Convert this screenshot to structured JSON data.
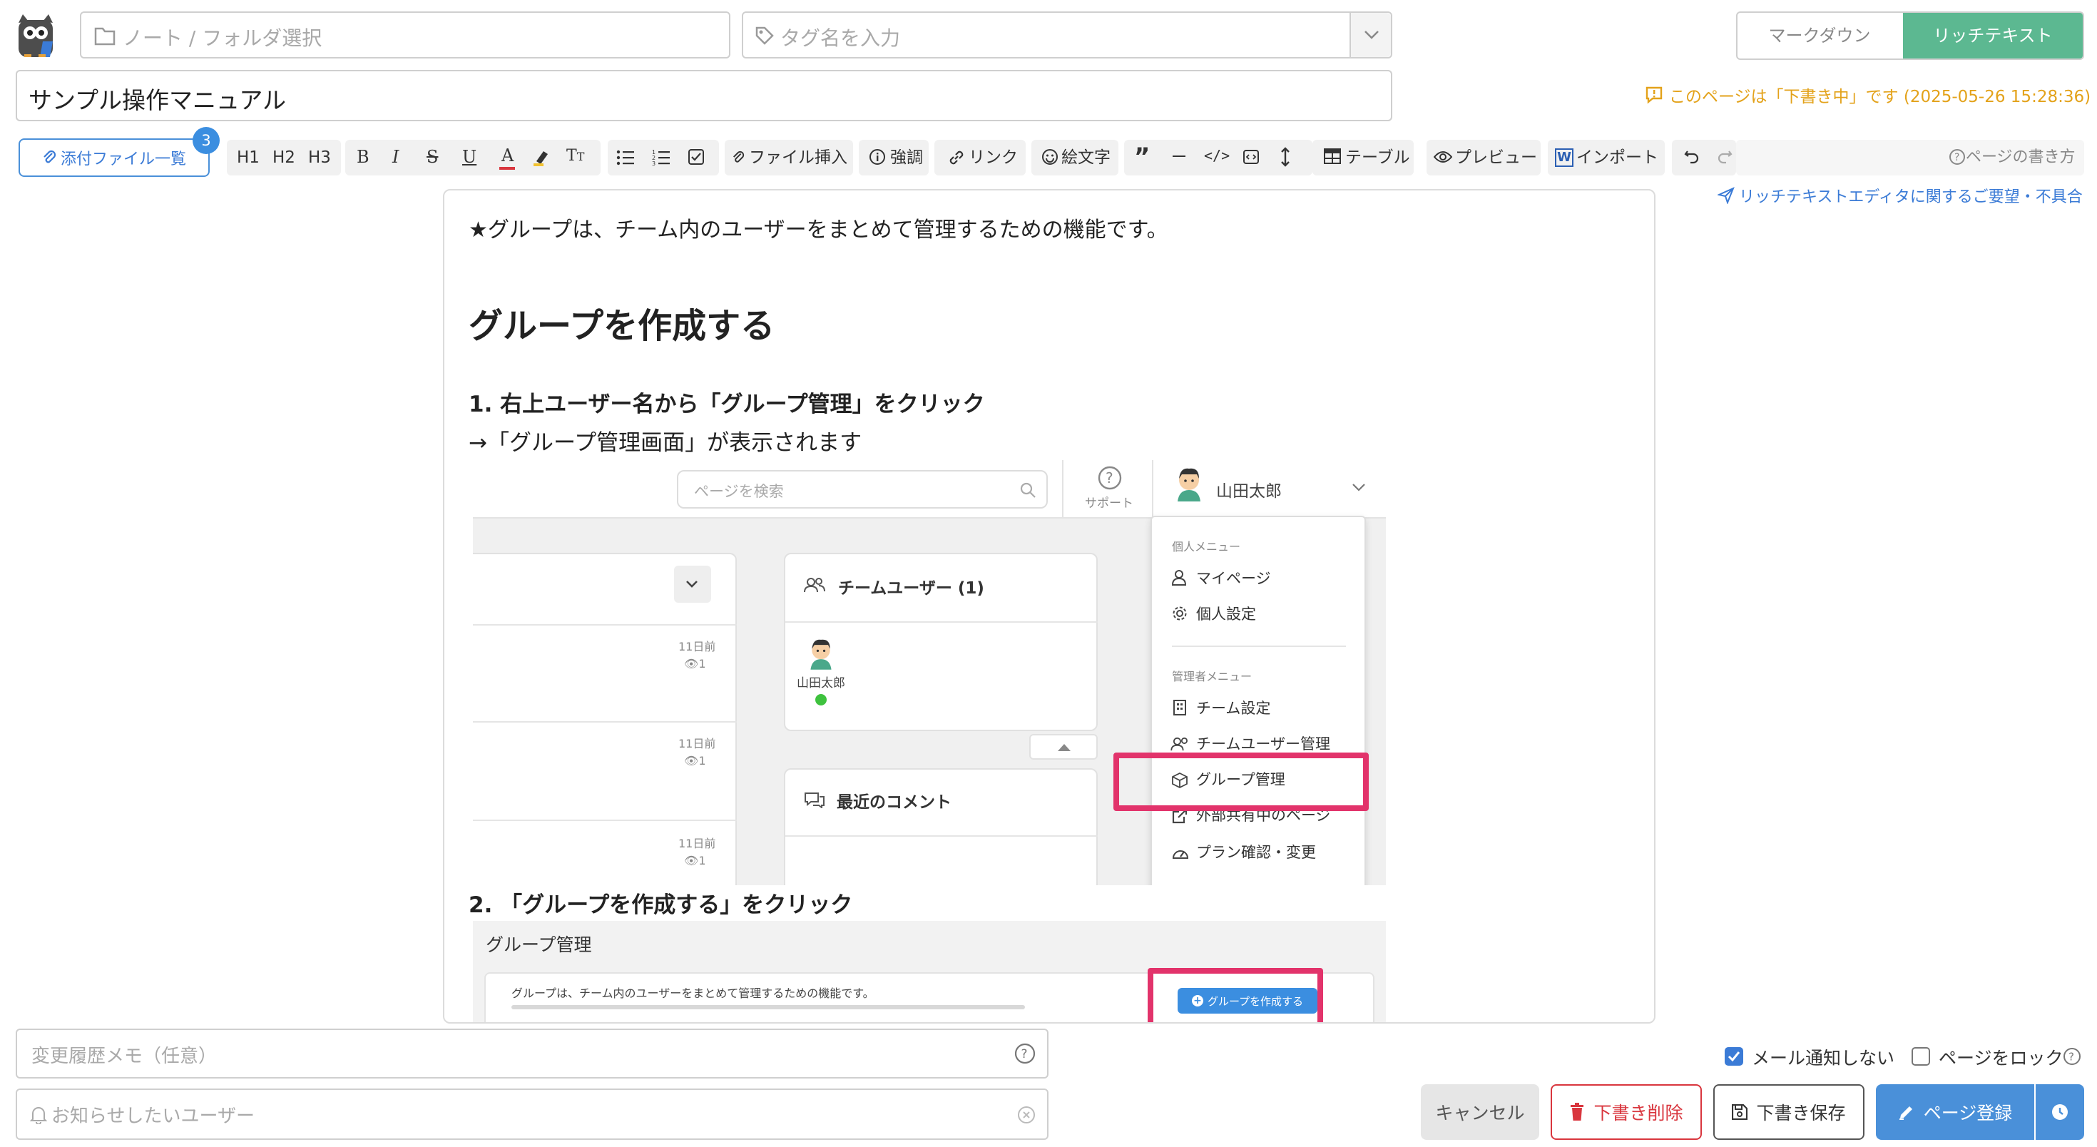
{
  "header": {
    "note_folder_placeholder": "ノート / フォルダ選択",
    "tag_placeholder": "タグ名を入力",
    "mode_markdown": "マークダウン",
    "mode_richtext": "リッチテキスト",
    "title_value": "サンプル操作マニュアル",
    "draft_notice": "このページは「下書き中」です (2025-05-26 15:28:36)"
  },
  "toolbar": {
    "attachments_label": "添付ファイル一覧",
    "attachments_count": "3",
    "h1": "H1",
    "h2": "H2",
    "h3": "H3",
    "file_insert": "ファイル挿入",
    "emphasis": "強調",
    "link": "リンク",
    "emoji": "絵文字",
    "table": "テーブル",
    "preview": "プレビュー",
    "import": "インポート",
    "howto": "ページの書き方",
    "feedback_link": "リッチテキストエディタに関するご要望・不具合"
  },
  "editor": {
    "intro": "★グループは、チーム内のユーザーをまとめて管理するための機能です。",
    "heading": "グループを作成する",
    "step1": "1. 右上ユーザー名から「グループ管理」をクリック",
    "step1_note": "→「グループ管理画面」が表示されます",
    "step2": "2. 「グループを作成する」をクリック"
  },
  "screenshot1": {
    "search_placeholder": "ページを検索",
    "support_label": "サポート",
    "user_name": "山田太郎",
    "team_users_title": "チームユーザー (1)",
    "team_member_name": "山田太郎",
    "recent_comments_title": "最近のコメント",
    "list_time": [
      "11日前",
      "11日前",
      "11日前"
    ],
    "list_views": [
      "1",
      "1",
      "1"
    ],
    "menu": {
      "personal_header": "個人メニュー",
      "mypage": "マイページ",
      "personal_settings": "個人設定",
      "admin_header": "管理者メニュー",
      "team_settings": "チーム設定",
      "team_user_admin": "チームユーザー管理",
      "group_admin": "グループ管理",
      "external_shared": "外部共有中のページ",
      "plan": "プラン確認・変更"
    }
  },
  "screenshot2": {
    "title": "グループ管理",
    "description": "グループは、チーム内のユーザーをまとめて管理するための機能です。",
    "create_button": "グループを作成する"
  },
  "footer": {
    "change_memo_placeholder": "変更履歴メモ（任意）",
    "notify_users_placeholder": "お知らせしたいユーザー",
    "no_email_label": "メール通知しない",
    "no_email_checked": true,
    "lock_page_label": "ページをロック",
    "lock_page_checked": false,
    "cancel": "キャンセル",
    "delete_draft": "下書き削除",
    "save_draft": "下書き保存",
    "register": "ページ登録"
  },
  "colors": {
    "accent_green": "#5cb891",
    "primary_blue": "#4a90d9",
    "danger_red": "#d9363e",
    "draft_orange": "#e3a21a",
    "highlight_pink": "#e2336b",
    "badge_blue": "#3b8ee0"
  }
}
